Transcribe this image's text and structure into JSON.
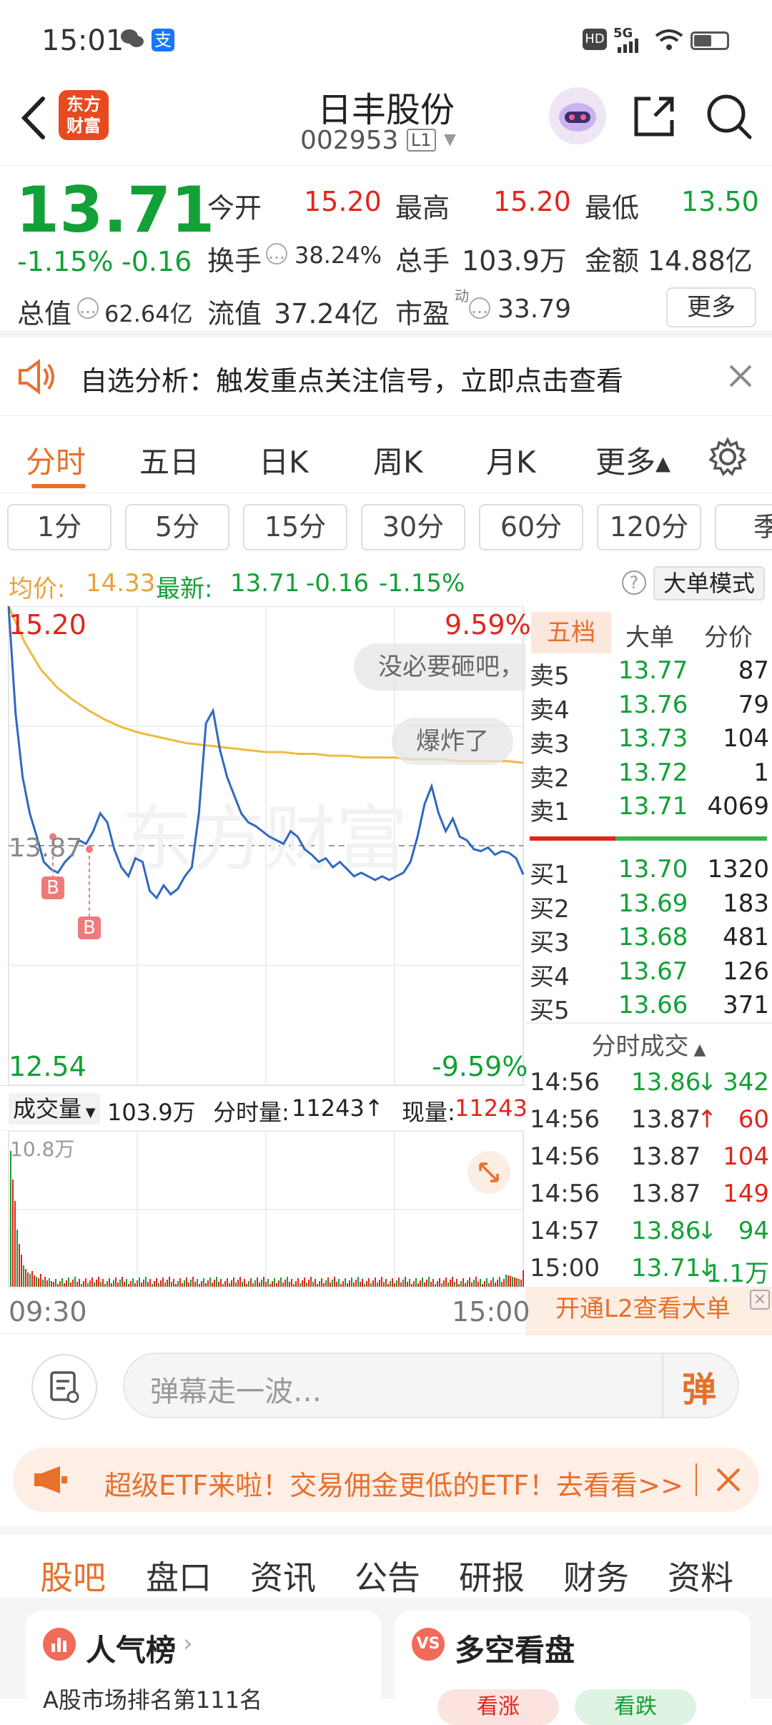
{
  "status_bar": {
    "time": "15:01",
    "network": "5G"
  },
  "header": {
    "logo_text_top": "东方",
    "logo_text_bottom": "财富",
    "title": "日丰股份",
    "code": "002953",
    "level_badge": "L1"
  },
  "quote": {
    "price": "13.71",
    "change_pct": "-1.15%",
    "change": "-0.16",
    "open_label": "今开",
    "open": "15.20",
    "high_label": "最高",
    "high": "15.20",
    "low_label": "最低",
    "low": "13.50",
    "turnover_label": "换手",
    "turnover": "38.24%",
    "volume_label": "总手",
    "volume": "103.9万",
    "amount_label": "金额",
    "amount": "14.88亿",
    "mcap_label": "总值",
    "mcap": "62.64亿",
    "float_label": "流值",
    "float": "37.24亿",
    "pe_label": "市盈",
    "pe_sup": "动",
    "pe": "33.79",
    "more_button": "更多"
  },
  "notice": {
    "text": "自选分析：触发重点关注信号，立即点击查看"
  },
  "chart_tabs": [
    "分时",
    "五日",
    "日K",
    "周K",
    "月K",
    "更多▴"
  ],
  "periods": [
    "1分",
    "5分",
    "15分",
    "30分",
    "60分",
    "120分",
    "季"
  ],
  "info_line": {
    "avg_label": "均价:",
    "avg": "14.33",
    "latest_label": "最新:",
    "latest": "13.71",
    "chg": "-0.16",
    "chg_pct": "-1.15%",
    "mode_button": "大单模式"
  },
  "chart_labels": {
    "top_price": "15.20",
    "top_pct": "9.59%",
    "mid_price": "13.87",
    "bottom_price": "12.54",
    "bottom_pct": "-9.59%",
    "marker": "B",
    "watermark": "东方财富",
    "bullet1": "没必要砸吧，",
    "bullet2": "爆炸了"
  },
  "chart_data": {
    "type": "line",
    "x_range": [
      "09:30",
      "15:00"
    ],
    "ylim": [
      12.54,
      15.2
    ],
    "prev_close": 13.87,
    "series": [
      {
        "name": "最新",
        "color": "#2f68c3",
        "values": [
          15.2,
          14.6,
          14.25,
          14.05,
          13.92,
          13.78,
          13.74,
          13.72,
          13.78,
          13.82,
          13.9,
          13.88,
          13.95,
          14.05,
          14.0,
          13.85,
          13.75,
          13.7,
          13.8,
          13.78,
          13.62,
          13.58,
          13.65,
          13.6,
          13.63,
          13.7,
          13.75,
          14.05,
          14.55,
          14.62,
          14.4,
          14.25,
          14.15,
          14.05,
          14.0,
          13.98,
          13.95,
          13.92,
          13.9,
          13.88,
          13.95,
          13.92,
          13.85,
          13.82,
          13.78,
          13.8,
          13.75,
          13.78,
          13.74,
          13.7,
          13.72,
          13.7,
          13.68,
          13.7,
          13.68,
          13.7,
          13.72,
          13.78,
          13.92,
          14.1,
          14.2,
          14.05,
          13.95,
          14.02,
          13.92,
          13.9,
          13.85,
          13.84,
          13.86,
          13.82,
          13.84,
          13.83,
          13.8,
          13.71
        ]
      },
      {
        "name": "均价",
        "color": "#f0b93f",
        "values": [
          15.2,
          15.0,
          14.85,
          14.75,
          14.68,
          14.62,
          14.57,
          14.53,
          14.5,
          14.48,
          14.46,
          14.44,
          14.43,
          14.42,
          14.41,
          14.4,
          14.39,
          14.39,
          14.38,
          14.38,
          14.37,
          14.37,
          14.36,
          14.36,
          14.36,
          14.35,
          14.35,
          14.35,
          14.34,
          14.34,
          14.34,
          14.34,
          14.33
        ]
      }
    ],
    "buy_markers": [
      13.92,
      13.85
    ]
  },
  "order_book": {
    "tabs": [
      "五档",
      "大单",
      "分价"
    ],
    "asks": [
      {
        "label": "卖5",
        "price": "13.77",
        "vol": "87"
      },
      {
        "label": "卖4",
        "price": "13.76",
        "vol": "79"
      },
      {
        "label": "卖3",
        "price": "13.73",
        "vol": "104"
      },
      {
        "label": "卖2",
        "price": "13.72",
        "vol": "1"
      },
      {
        "label": "卖1",
        "price": "13.71",
        "vol": "4069"
      }
    ],
    "bids": [
      {
        "label": "买1",
        "price": "13.70",
        "vol": "1320"
      },
      {
        "label": "买2",
        "price": "13.69",
        "vol": "183"
      },
      {
        "label": "买3",
        "price": "13.68",
        "vol": "481"
      },
      {
        "label": "买4",
        "price": "13.67",
        "vol": "126"
      },
      {
        "label": "买5",
        "price": "13.66",
        "vol": "371"
      }
    ],
    "trades_title": "分时成交",
    "trades": [
      {
        "time": "14:56",
        "price": "13.86",
        "dir": "↓",
        "vol": "342"
      },
      {
        "time": "14:56",
        "price": "13.87",
        "dir": "↑",
        "vol": "60"
      },
      {
        "time": "14:56",
        "price": "13.87",
        "dir": "",
        "vol": "104"
      },
      {
        "time": "14:56",
        "price": "13.87",
        "dir": "",
        "vol": "149"
      },
      {
        "time": "14:57",
        "price": "13.86",
        "dir": "↓",
        "vol": "94"
      },
      {
        "time": "15:00",
        "price": "13.71",
        "dir": "↓",
        "vol": "1.1万"
      }
    ],
    "l2_banner": "开通L2查看大单"
  },
  "volume": {
    "dropdown": "成交量",
    "total": "103.9万",
    "minute_label": "分时量:",
    "minute_value": "11243↑",
    "current_label": "现量:",
    "current_value": "11243",
    "max_label": "10.8万"
  },
  "time_axis": {
    "start": "09:30",
    "end": "15:00"
  },
  "danmaku": {
    "placeholder": "弹幕走一波…",
    "send_icon_text": "弹"
  },
  "banner": {
    "text": "超级ETF来啦！交易佣金更低的ETF！去看看>>"
  },
  "bottom_tabs": [
    "股吧",
    "盘口",
    "资讯",
    "公告",
    "研报",
    "财务",
    "资料"
  ],
  "cards": {
    "popularity_title": "人气榜",
    "popularity_sub": "A股市场排名第111名",
    "bullbear_title": "多空看盘",
    "bullbear_up": "看涨",
    "bullbear_down": "看跌"
  }
}
